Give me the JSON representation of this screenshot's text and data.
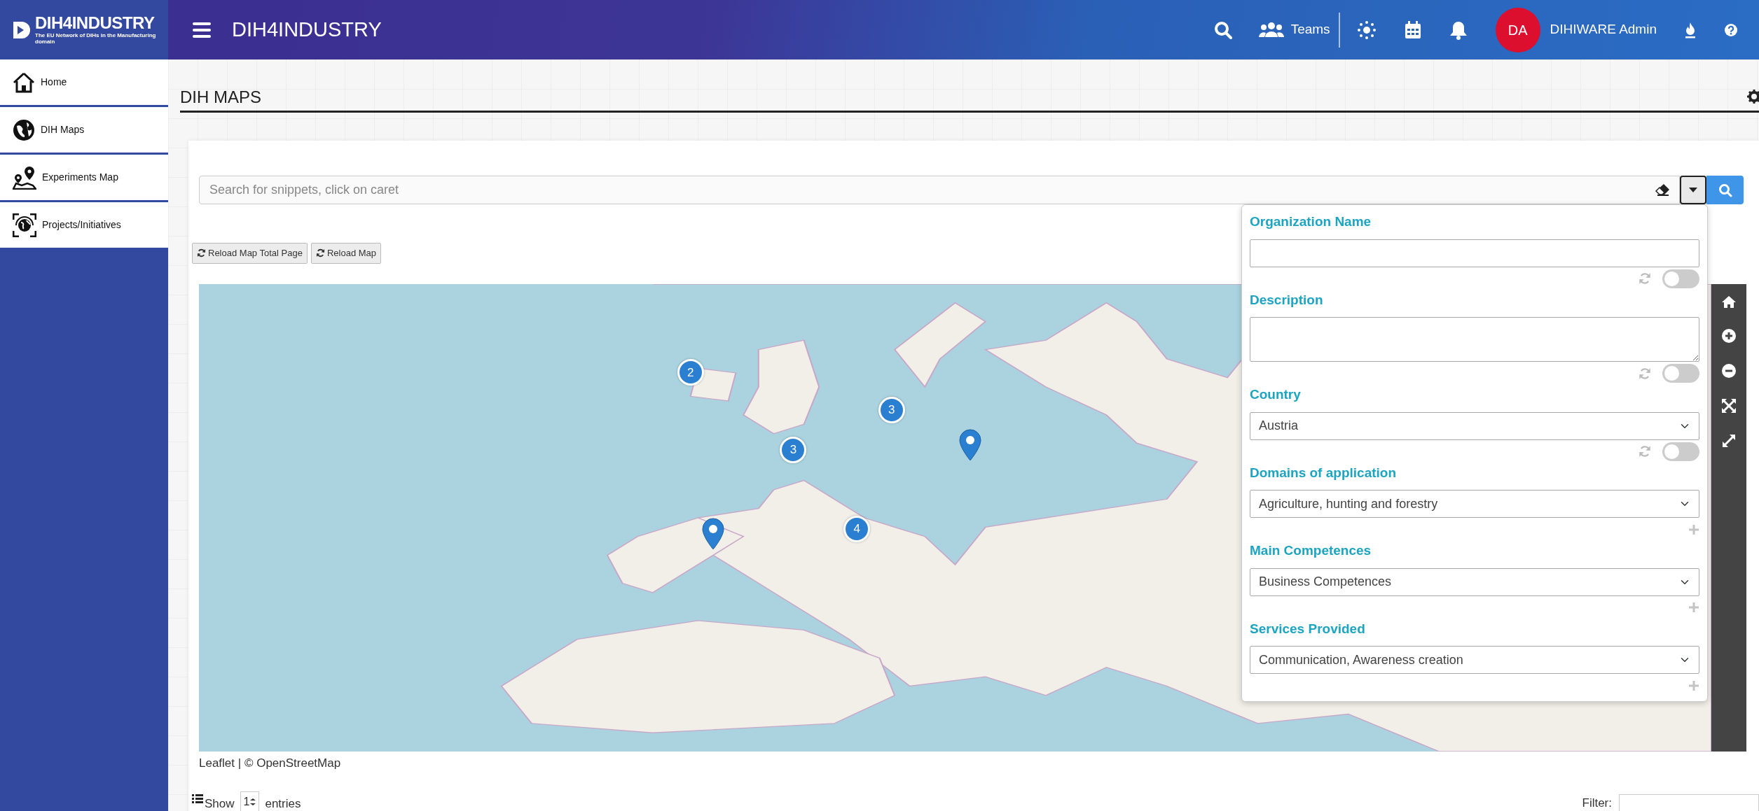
{
  "header": {
    "logo_text": "DIH4INDUSTRY",
    "logo_tagline": "The EU Network of DIHs in the Manufacturing domain",
    "app_title": "DIH4INDUSTRY",
    "teams": "Teams",
    "avatar": "DA",
    "user": "DIHIWARE Admin"
  },
  "sidebar": {
    "items": [
      {
        "label": "Home",
        "kind": "home"
      },
      {
        "label": "DIH Maps",
        "kind": "globe"
      },
      {
        "label": "Experiments Map",
        "kind": "pins"
      },
      {
        "label": "Projects/Initiatives",
        "kind": "target"
      }
    ]
  },
  "page_title": "DIH MAPS",
  "search": {
    "placeholder": "Search for snippets, click on caret"
  },
  "buttons": [
    "Reload Map Total Page",
    "Reload Map"
  ],
  "map": {
    "markers": [
      {
        "kind": "cluster",
        "count": "2"
      },
      {
        "kind": "cluster",
        "count": "3"
      },
      {
        "kind": "cluster",
        "count": "3"
      },
      {
        "kind": "cluster",
        "count": "4"
      },
      {
        "kind": "pin"
      },
      {
        "kind": "pin"
      }
    ],
    "attribution": "Leaflet | © OpenStreetMap"
  },
  "filter_panel": {
    "fields": [
      {
        "label": "Organization Name",
        "kind": "text",
        "trailing": {
          "kind": "toggle",
          "on": false
        }
      },
      {
        "label": "Description",
        "kind": "textarea",
        "trailing": {
          "kind": "toggle",
          "on": false
        }
      },
      {
        "label": "Country",
        "kind": "select",
        "value": "Austria",
        "trailing": {
          "kind": "toggle",
          "on": false
        }
      },
      {
        "label": "Domains of application",
        "kind": "select",
        "value": "Agriculture, hunting and forestry",
        "trailing": {
          "kind": "add"
        }
      },
      {
        "label": "Main Competences",
        "kind": "select",
        "value": "Business Competences",
        "trailing": {
          "kind": "add"
        }
      },
      {
        "label": "Services Provided",
        "kind": "select",
        "value": "Communication, Awareness creation",
        "trailing": {
          "kind": "add"
        }
      }
    ]
  },
  "table_controls": {
    "show": "Show",
    "length": "1",
    "entries": "entries",
    "filter_label": "Filter:"
  }
}
